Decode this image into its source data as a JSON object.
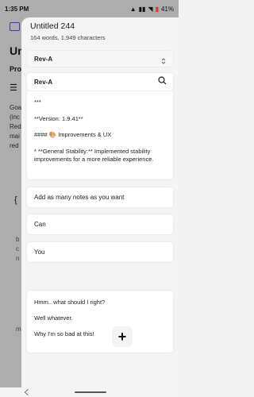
{
  "status_bar": {
    "time": "1:35 PM",
    "battery": "41%"
  },
  "background_app": {
    "title": "Un",
    "label_pro": "Pro",
    "text_goal": "Goa (inc Red mai red",
    "brace": "{",
    "green_1": "b c n",
    "green_2": "m"
  },
  "sheet": {
    "title": "Untitled 244",
    "meta": "164 words, 1,949 characters",
    "dropdown_value": "Rev-A",
    "section_header": "Rev-A",
    "content_lines": [
      "***",
      "**Version: 1.9.41**",
      "#### 🎨 Improvements & UX",
      "* **General Stability:** Implemented stability improvements for a more reliable experience."
    ],
    "notes": [
      "Add as many notes as you want",
      "Can",
      "You"
    ],
    "multi_note_lines": [
      "Hmm.. what should I right?",
      "Well whatever.",
      "Why I'm so bad at this!"
    ],
    "fab_label": "+"
  },
  "colors": {
    "accent": "#6a5acd",
    "battery": "#e53935",
    "green_text": "#2e7d32"
  },
  "icons": {
    "dropdown": "unfold-icon",
    "search": "search-icon",
    "add": "plus-icon"
  }
}
